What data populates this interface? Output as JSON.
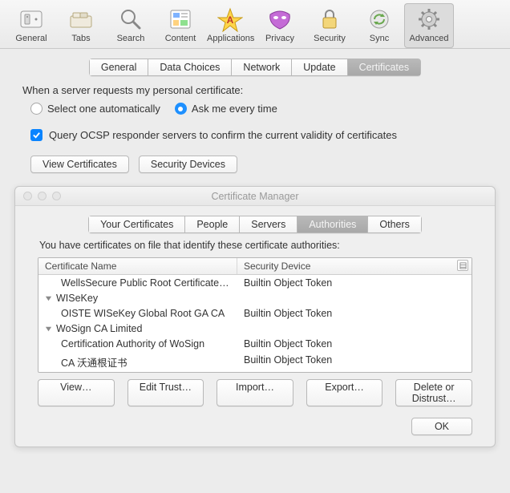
{
  "toolbar": {
    "items": [
      {
        "id": "general",
        "label": "General"
      },
      {
        "id": "tabs",
        "label": "Tabs"
      },
      {
        "id": "search",
        "label": "Search"
      },
      {
        "id": "content",
        "label": "Content"
      },
      {
        "id": "applications",
        "label": "Applications"
      },
      {
        "id": "privacy",
        "label": "Privacy"
      },
      {
        "id": "security",
        "label": "Security"
      },
      {
        "id": "sync",
        "label": "Sync"
      },
      {
        "id": "advanced",
        "label": "Advanced"
      }
    ],
    "selected": "advanced"
  },
  "advanced_tabs": {
    "items": [
      "General",
      "Data Choices",
      "Network",
      "Update",
      "Certificates"
    ],
    "selected": "Certificates"
  },
  "cert_panel": {
    "heading": "When a server requests my personal certificate:",
    "radio_auto": "Select one automatically",
    "radio_ask": "Ask me every time",
    "radio_value": "ask",
    "ocsp_checked": true,
    "ocsp_label": "Query OCSP responder servers to confirm the current validity of certificates",
    "view_btn": "View Certificates",
    "devices_btn": "Security Devices"
  },
  "sheet": {
    "title": "Certificate Manager",
    "tabs": [
      "Your Certificates",
      "People",
      "Servers",
      "Authorities",
      "Others"
    ],
    "tabs_selected": "Authorities",
    "desc": "You have certificates on file that identify these certificate authorities:",
    "columns": {
      "c1": "Certificate Name",
      "c2": "Security Device"
    },
    "rows": [
      {
        "type": "item",
        "name": "WellsSecure Public Root Certificate …",
        "device": "Builtin Object Token"
      },
      {
        "type": "group",
        "name": "WISeKey"
      },
      {
        "type": "item",
        "name": "OISTE WISeKey Global Root GA CA",
        "device": "Builtin Object Token"
      },
      {
        "type": "group",
        "name": "WoSign CA Limited"
      },
      {
        "type": "item",
        "name": "Certification Authority of WoSign",
        "device": "Builtin Object Token"
      },
      {
        "type": "item",
        "name": "CA 沃通根证书",
        "device": "Builtin Object Token"
      }
    ],
    "actions": {
      "view": "View…",
      "edit": "Edit Trust…",
      "import": "Import…",
      "export": "Export…",
      "delete": "Delete or Distrust…"
    },
    "ok": "OK"
  }
}
